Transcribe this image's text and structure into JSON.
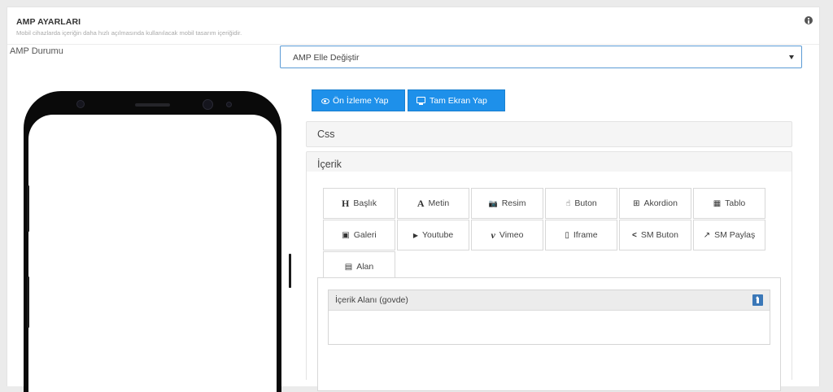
{
  "settings": {
    "title": "AMP AYARLARI",
    "subtitle": "Mobil cihazlarda içeriğin daha hızlı açılmasında kullanılacak mobil tasarım içeriğidir.",
    "info_icon": "info-icon"
  },
  "amp_status": {
    "label": "AMP Durumu",
    "selected": "AMP Elle Değiştir"
  },
  "actions": {
    "preview_label": "Ön İzleme Yap",
    "fullscreen_label": "Tam Ekran Yap"
  },
  "sections": {
    "css_label": "Css",
    "content_label": "İçerik"
  },
  "tools": [
    {
      "label": "Başlık",
      "icon": "H"
    },
    {
      "label": "Metin",
      "icon": "A"
    },
    {
      "label": "Resim",
      "icon": "📷"
    },
    {
      "label": "Buton",
      "icon": "☝"
    },
    {
      "label": "Akordion",
      "icon": "⊞"
    },
    {
      "label": "Tablo",
      "icon": "▦"
    },
    {
      "label": "Galeri",
      "icon": "▣"
    },
    {
      "label": "Youtube",
      "icon": "▶"
    },
    {
      "label": "Vimeo",
      "icon": "v"
    },
    {
      "label": "Iframe",
      "icon": "▯"
    },
    {
      "label": "SM Buton",
      "icon": "<"
    },
    {
      "label": "SM Paylaş",
      "icon": "↗"
    },
    {
      "label": "Alan",
      "icon": "▤"
    }
  ],
  "content_area": {
    "title": "İçerik Alanı (govde)"
  },
  "colors": {
    "accent": "#1e90ea",
    "panel_bg": "#ffffff",
    "page_bg": "#ebebeb"
  }
}
